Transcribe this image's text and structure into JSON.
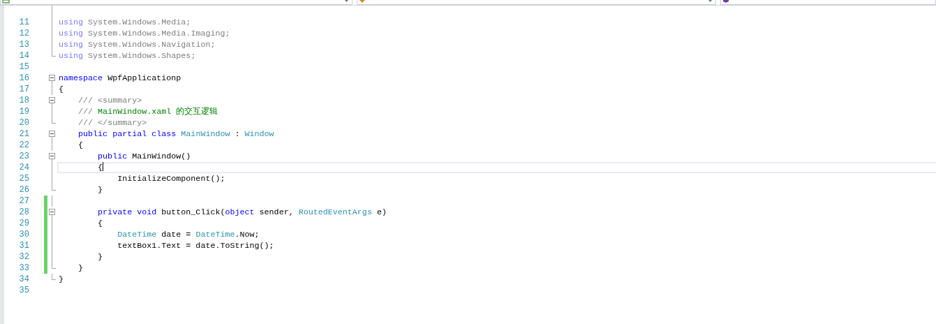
{
  "navigation_bar": [
    {
      "kind": "project"
    },
    {
      "kind": "class"
    },
    {
      "kind": "method"
    }
  ],
  "editor": {
    "lines": [
      {
        "number": "11",
        "kind": "fold-inner",
        "changed": false,
        "current": false,
        "tokens": [
          {
            "text": "using",
            "kind": "faded-keyword"
          },
          {
            "text": " System.Windows.Media;",
            "kind": "faded"
          }
        ]
      },
      {
        "number": "12",
        "kind": "fold-inner",
        "changed": false,
        "current": false,
        "tokens": [
          {
            "text": "using",
            "kind": "faded-keyword"
          },
          {
            "text": " System.Windows.Media.Imaging;",
            "kind": "faded"
          }
        ]
      },
      {
        "number": "13",
        "kind": "fold-inner",
        "changed": false,
        "current": false,
        "tokens": [
          {
            "text": "using",
            "kind": "faded-keyword"
          },
          {
            "text": " System.Windows.Navigation;",
            "kind": "faded"
          }
        ]
      },
      {
        "number": "14",
        "kind": "fold-end",
        "changed": false,
        "current": false,
        "tokens": [
          {
            "text": "using",
            "kind": "faded-keyword"
          },
          {
            "text": " System.Windows.Shapes;",
            "kind": "faded"
          }
        ]
      },
      {
        "number": "15",
        "kind": "plain",
        "changed": false,
        "current": false
      },
      {
        "number": "16",
        "kind": "fold-start",
        "changed": false,
        "current": false,
        "tokens": [
          {
            "text": "namespace",
            "kind": "keyword"
          },
          {
            "text": " WpfApplicationp",
            "kind": "plain"
          }
        ]
      },
      {
        "number": "17",
        "kind": "fold-inner",
        "changed": false,
        "current": false,
        "tokens": [
          {
            "text": "{",
            "kind": "plain"
          }
        ]
      },
      {
        "number": "18",
        "kind": "fold-start",
        "changed": false,
        "current": false,
        "tokens": [
          {
            "text": "    /// <summary>",
            "kind": "doc"
          }
        ]
      },
      {
        "number": "19",
        "kind": "fold-inner",
        "changed": false,
        "current": false,
        "tokens": [
          {
            "text": "    /// ",
            "kind": "doc"
          },
          {
            "text": "MainWindow.xaml 的交互逻辑",
            "kind": "comment"
          }
        ]
      },
      {
        "number": "20",
        "kind": "fold-end",
        "changed": false,
        "current": false,
        "tokens": [
          {
            "text": "    /// </summary>",
            "kind": "doc"
          }
        ]
      },
      {
        "number": "21",
        "kind": "fold-start",
        "changed": false,
        "current": false,
        "tokens": [
          {
            "text": "    public partial class ",
            "kind": "keyword"
          },
          {
            "text": "MainWindow",
            "kind": "type"
          },
          {
            "text": " : ",
            "kind": "plain"
          },
          {
            "text": "Window",
            "kind": "type"
          }
        ]
      },
      {
        "number": "22",
        "kind": "fold-inner",
        "changed": false,
        "current": false,
        "tokens": [
          {
            "text": "    {",
            "kind": "plain"
          }
        ]
      },
      {
        "number": "23",
        "kind": "fold-start",
        "changed": false,
        "current": false,
        "tokens": [
          {
            "text": "        public",
            "kind": "keyword"
          },
          {
            "text": " MainWindow()",
            "kind": "plain"
          }
        ]
      },
      {
        "number": "24",
        "kind": "fold-inner",
        "changed": false,
        "current": true,
        "tokens": [
          {
            "text": "        {",
            "kind": "plain"
          }
        ]
      },
      {
        "number": "25",
        "kind": "fold-inner",
        "changed": false,
        "current": false,
        "tokens": [
          {
            "text": "            InitializeComponent();",
            "kind": "plain"
          }
        ]
      },
      {
        "number": "26",
        "kind": "fold-end",
        "changed": false,
        "current": false,
        "tokens": [
          {
            "text": "        }",
            "kind": "plain"
          }
        ]
      },
      {
        "number": "27",
        "kind": "fold-inner",
        "changed": true,
        "current": false
      },
      {
        "number": "28",
        "kind": "fold-start",
        "changed": true,
        "current": false,
        "tokens": [
          {
            "text": "        private void",
            "kind": "keyword"
          },
          {
            "text": " button_Click(",
            "kind": "plain"
          },
          {
            "text": "object",
            "kind": "keyword"
          },
          {
            "text": " sender, ",
            "kind": "plain"
          },
          {
            "text": "RoutedEventArgs",
            "kind": "type"
          },
          {
            "text": " e)",
            "kind": "plain"
          }
        ]
      },
      {
        "number": "29",
        "kind": "fold-inner",
        "changed": true,
        "current": false,
        "tokens": [
          {
            "text": "        {",
            "kind": "plain"
          }
        ]
      },
      {
        "number": "30",
        "kind": "fold-inner",
        "changed": true,
        "current": false,
        "tokens": [
          {
            "text": "            DateTime",
            "kind": "type"
          },
          {
            "text": " date = ",
            "kind": "plain"
          },
          {
            "text": "DateTime",
            "kind": "type"
          },
          {
            "text": ".Now;",
            "kind": "plain"
          }
        ]
      },
      {
        "number": "31",
        "kind": "fold-inner",
        "changed": true,
        "current": false,
        "tokens": [
          {
            "text": "            textBox1.Text = date.ToString();",
            "kind": "plain"
          }
        ]
      },
      {
        "number": "32",
        "kind": "fold-inner",
        "changed": true,
        "current": false,
        "tokens": [
          {
            "text": "        }",
            "kind": "plain"
          }
        ]
      },
      {
        "number": "33",
        "kind": "fold-end",
        "changed": true,
        "current": false,
        "tokens": [
          {
            "text": "    }",
            "kind": "plain"
          }
        ]
      },
      {
        "number": "34",
        "kind": "fold-end",
        "changed": false,
        "current": false,
        "tokens": [
          {
            "text": "}",
            "kind": "plain"
          }
        ]
      },
      {
        "number": "35",
        "kind": "plain",
        "changed": false,
        "current": false
      }
    ]
  }
}
